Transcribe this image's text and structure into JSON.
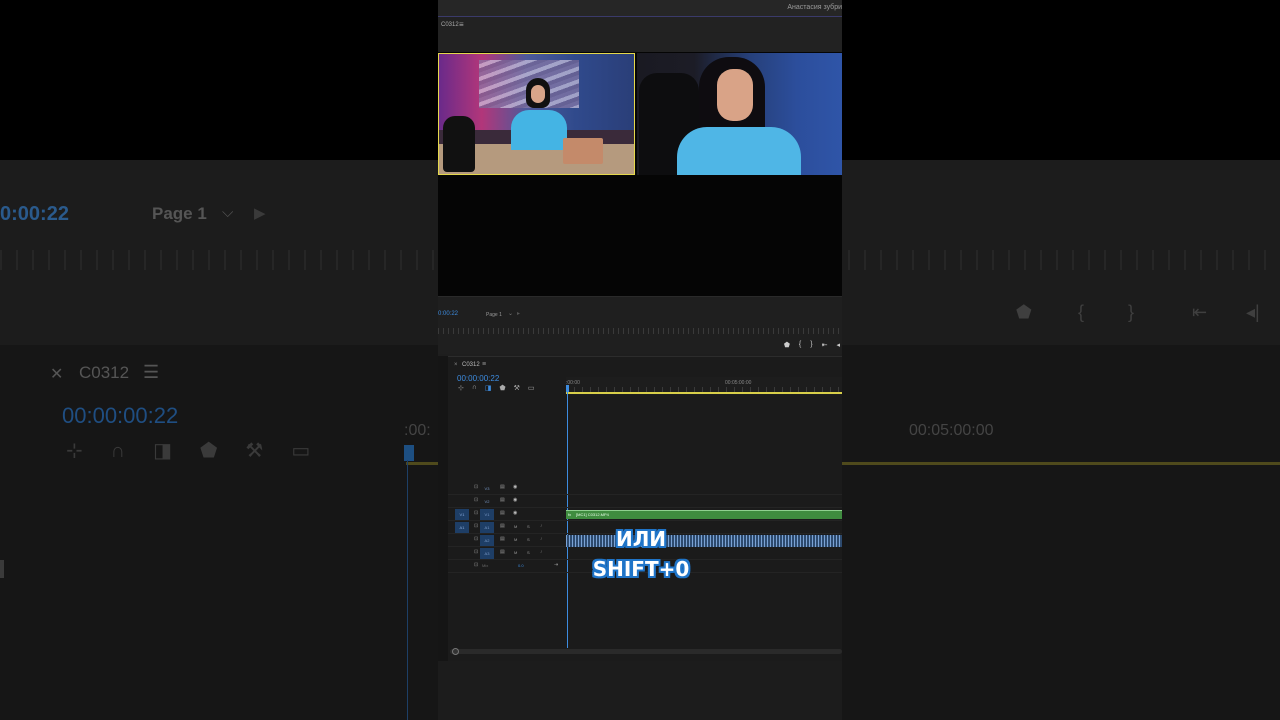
{
  "background": {
    "timecode": "0:00:22",
    "page": "Page 1",
    "sequence_name": "C0312",
    "sequence_timecode": "00:00:00:22",
    "ruler_time": "00:05:00:00",
    "ruler_left_time": ":00:"
  },
  "header": {
    "user_name": "Анастасия зубри",
    "sequence_tab": "C0312"
  },
  "program_monitor": {
    "timecode": "0:00:22",
    "page_label": "Page 1"
  },
  "timeline": {
    "sequence_name": "C0312",
    "timecode": "00:00:00:22",
    "ruler_start": ":00:00",
    "ruler_mark": "00:05:00:00",
    "video_tracks": [
      {
        "id": "V3",
        "source": ""
      },
      {
        "id": "V2",
        "source": ""
      },
      {
        "id": "V1",
        "source": "V1"
      }
    ],
    "audio_tracks": [
      {
        "id": "A1",
        "source": "A1"
      },
      {
        "id": "A2",
        "source": "A2"
      },
      {
        "id": "A3",
        "source": "A3"
      }
    ],
    "mix_label": "Mix",
    "mix_value": "0.0",
    "clip_label": "[MC1] C0312.MP4",
    "clip_fx": "fx"
  },
  "caption": {
    "line1": "ИЛИ",
    "line2": "SHIFT+0"
  },
  "colors": {
    "timecode_blue": "#3d8ce0",
    "clip_green": "#3f8c3f",
    "caption_outline": "#1f74c8",
    "work_area_yellow": "#d8cf4a"
  }
}
